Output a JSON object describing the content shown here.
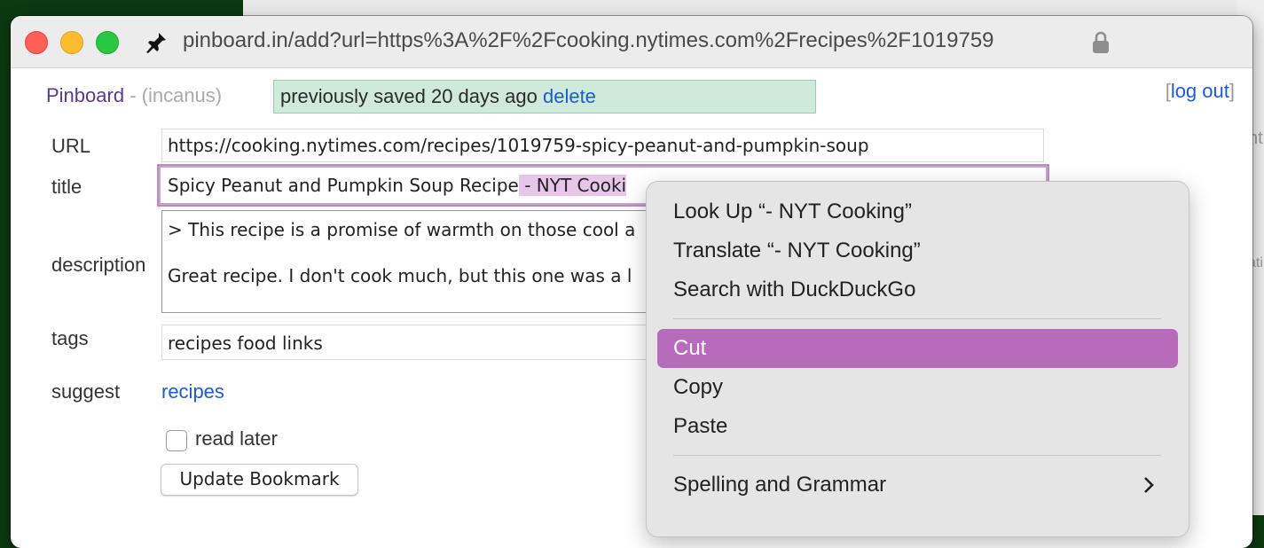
{
  "browser": {
    "address": "pinboard.in/add?url=https%3A%2F%2Fcooking.nytimes.com%2Frecipes%2F1019759"
  },
  "header": {
    "brand": "Pinboard",
    "separator": " - ",
    "user": "(incanus)",
    "notice_text": "previously saved 20 days ago ",
    "notice_delete": "delete",
    "logout_open": "[",
    "logout_label": "log out",
    "logout_close": "]"
  },
  "form": {
    "url_label": "URL",
    "url_value": "https://cooking.nytimes.com/recipes/1019759-spicy-peanut-and-pumpkin-soup",
    "title_label": "title",
    "title_value_plain": "Spicy Peanut and Pumpkin Soup Recipe",
    "title_value_selected": " - NYT Cooki",
    "description_label": "description",
    "description_line1": "> This recipe is a promise of warmth on those cool a",
    "description_line2": "Great recipe. I don't cook much, but this one was a l",
    "tags_label": "tags",
    "tags_value": "recipes food links",
    "suggest_label": "suggest",
    "suggest_link": "recipes",
    "read_later_label": "read later",
    "read_later_checked": false,
    "submit_label": "Update Bookmark"
  },
  "context_menu": {
    "items": [
      {
        "label": "Look Up “- NYT Cooking”"
      },
      {
        "label": "Translate “- NYT Cooking”"
      },
      {
        "label": "Search with DuckDuckGo"
      },
      {
        "label": "Cut"
      },
      {
        "label": "Copy"
      },
      {
        "label": "Paste"
      },
      {
        "label": "Spelling and Grammar"
      }
    ],
    "highlighted": "Cut",
    "highlight_color": "#b66bbb"
  },
  "background_window": {
    "fragment1": "nt",
    "fragment2": "ati"
  },
  "colors": {
    "desktop": "#0c3a10",
    "brand": "#5a3a8e",
    "link": "#1c5bd6",
    "notice_bg": "#cfeadb"
  }
}
